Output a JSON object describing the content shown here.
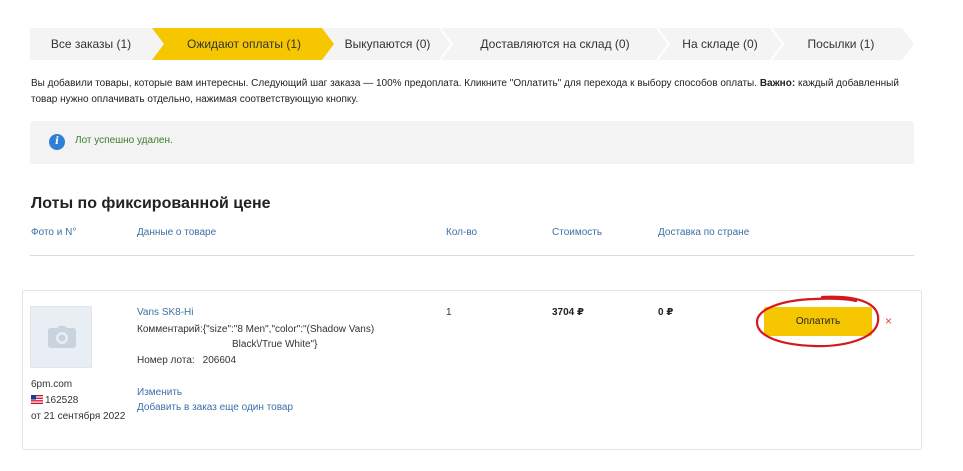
{
  "tabs": [
    {
      "label": "Все заказы (1)",
      "active": false
    },
    {
      "label": "Ожидают оплаты (1)",
      "active": true
    },
    {
      "label": "Выкупаются (0)",
      "active": false
    },
    {
      "label": "Доставляются на склад (0)",
      "active": false
    },
    {
      "label": "На складе (0)",
      "active": false
    },
    {
      "label": "Посылки (1)",
      "active": false
    }
  ],
  "info": {
    "text": "Вы добавили товары, которые вам интересны. Следующий шаг заказа — 100% предоплата. Кликните \"Оплатить\" для перехода к выбору способов оплаты.",
    "bold": "Важно:",
    "text2": "каждый добавленный товар нужно оплачивать отдельно, нажимая соответствующую кнопку."
  },
  "alert": {
    "icon": "info-icon",
    "text": "Лот успешно удален."
  },
  "section_title": "Лоты по фиксированной цене",
  "columns": {
    "photo": "Фото и N°",
    "product": "Данные о товаре",
    "qty": "Кол-во",
    "cost": "Стоимость",
    "delivery": "Доставка по стране"
  },
  "lot": {
    "image_icon": "camera-icon",
    "shop": "6pm.com",
    "flag_icon": "us-flag-icon",
    "lot_id": "162528",
    "date": "от 21 сентября 2022",
    "product_name": "Vans SK8-Hi",
    "comment_label": "Комментарий:",
    "comment_line1": "{\"size\":\"8 Men\",\"color\":\"(Shadow Vans)",
    "comment_line2": "Black\\/True White\"}",
    "lot_number_label": "Номер лота:",
    "lot_number": "206604",
    "edit_label": "Изменить",
    "add_label": "Добавить в заказ еще один товар",
    "qty": "1",
    "cost": "3704 ₽",
    "delivery": "0 ₽",
    "pay_label": "Оплатить",
    "remove_icon": "×"
  },
  "colors": {
    "accent": "#f6c700",
    "link": "#3d6fa8",
    "remove": "#e0443a",
    "annotation": "#d4191b"
  }
}
